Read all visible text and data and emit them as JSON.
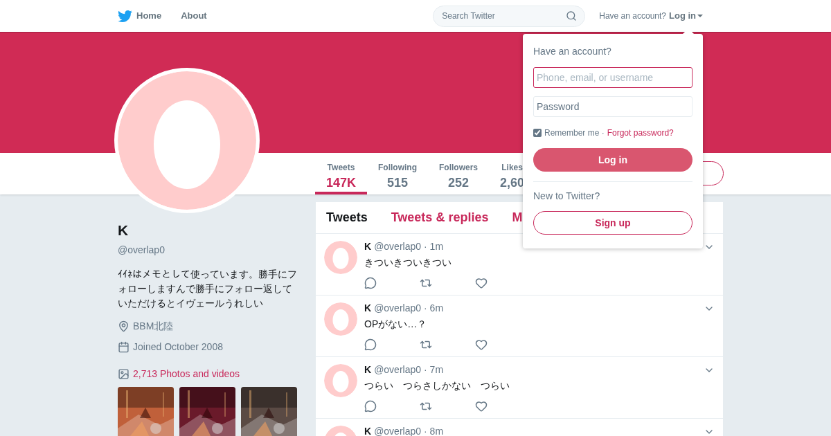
{
  "nav": {
    "items": [
      {
        "label": "Home",
        "kind": "home"
      },
      {
        "label": "About",
        "kind": "plain"
      }
    ],
    "search": {
      "placeholder": "Search Twitter"
    },
    "account_prompt": "Have an account?",
    "login_link": "Log in"
  },
  "stats": [
    {
      "label": "Tweets",
      "value": "147K",
      "selected": true
    },
    {
      "label": "Following",
      "value": "515",
      "selected": false
    },
    {
      "label": "Followers",
      "value": "252",
      "selected": false
    },
    {
      "label": "Likes",
      "value": "2,60",
      "selected": false
    }
  ],
  "profile": {
    "name": "K",
    "handle": "@overlap0",
    "bio": "ｲｲﾈはメモとして使っています。勝手にフォローしますんで勝手にフォロー返していただけるとイヴェールうれしい",
    "location": "BBM北陸",
    "joined": "Joined October 2008",
    "photos_link": "2,713 Photos and videos"
  },
  "timeline_tabs": [
    {
      "label": "Tweets",
      "selected": true
    },
    {
      "label": "Tweets & replies",
      "selected": false
    },
    {
      "label": "M",
      "selected": false
    }
  ],
  "tweets": [
    {
      "name": "K",
      "handle": "@overlap0",
      "time": "· 1m",
      "text": "きついきついきつい"
    },
    {
      "name": "K",
      "handle": "@overlap0",
      "time": "· 6m",
      "text": "OPがない…？"
    },
    {
      "name": "K",
      "handle": "@overlap0",
      "time": "· 7m",
      "text": "つらい　つらさしかない　つらい"
    },
    {
      "name": "K",
      "handle": "@overlap0",
      "time": "· 8m"
    }
  ],
  "login_dropdown": {
    "title": "Have an account?",
    "username_placeholder": "Phone, email, or username",
    "password_placeholder": "Password",
    "remember_label": "Remember me ·",
    "remember_checked": true,
    "forgot_link": "Forgot password?",
    "login_button": "Log in",
    "new_prompt": "New to Twitter?",
    "signup_button": "Sign up"
  }
}
